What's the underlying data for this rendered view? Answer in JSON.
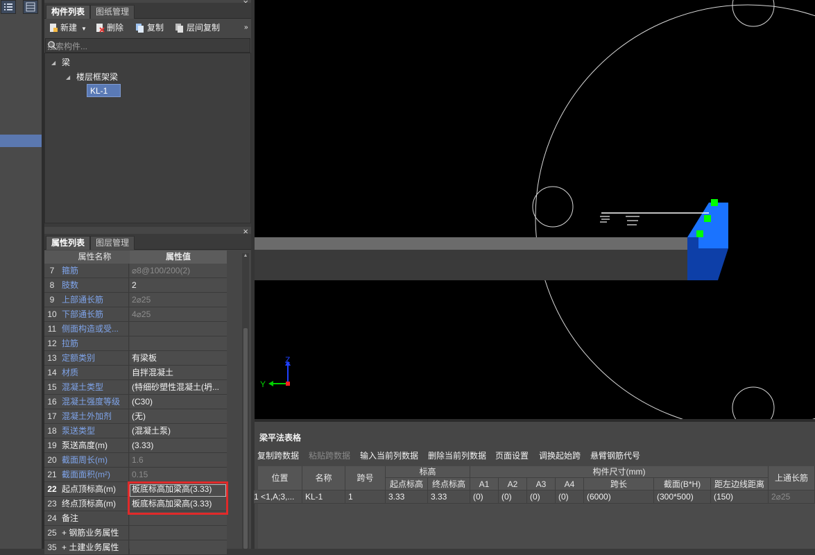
{
  "component_panel": {
    "tabs": [
      "构件列表",
      "图纸管理"
    ],
    "toolbar": {
      "new": "新建",
      "delete": "删除",
      "copy": "复制",
      "floor_copy": "层间复制"
    },
    "search_placeholder": "搜索构件...",
    "tree": {
      "root": "梁",
      "group": "楼层框架梁",
      "item": "KL-1"
    }
  },
  "properties_panel": {
    "tabs": [
      "属性列表",
      "图层管理"
    ],
    "headers": {
      "name": "属性名称",
      "value": "属性值"
    },
    "rows": [
      {
        "num": "7",
        "name": "箍筋",
        "value": "⌀8@100/200(2)",
        "name_style": "blue",
        "value_style": "grey"
      },
      {
        "num": "8",
        "name": "肢数",
        "value": "2",
        "name_style": "blue",
        "value_style": "white"
      },
      {
        "num": "9",
        "name": "上部通长筋",
        "value": "2⌀25",
        "name_style": "blue",
        "value_style": "grey"
      },
      {
        "num": "10",
        "name": "下部通长筋",
        "value": "4⌀25",
        "name_style": "blue",
        "value_style": "grey"
      },
      {
        "num": "11",
        "name": "侧面构造或受...",
        "value": "",
        "name_style": "blue",
        "value_style": "grey"
      },
      {
        "num": "12",
        "name": "拉筋",
        "value": "",
        "name_style": "blue",
        "value_style": "grey"
      },
      {
        "num": "13",
        "name": "定额类别",
        "value": "有梁板",
        "name_style": "blue",
        "value_style": "white"
      },
      {
        "num": "14",
        "name": "材质",
        "value": "自拌混凝土",
        "name_style": "blue",
        "value_style": "white"
      },
      {
        "num": "15",
        "name": "混凝土类型",
        "value": "(特细砂塑性混凝土(坍...",
        "name_style": "blue",
        "value_style": "white"
      },
      {
        "num": "16",
        "name": "混凝土强度等级",
        "value": "(C30)",
        "name_style": "blue",
        "value_style": "white"
      },
      {
        "num": "17",
        "name": "混凝土外加剂",
        "value": "(无)",
        "name_style": "blue",
        "value_style": "white"
      },
      {
        "num": "18",
        "name": "泵送类型",
        "value": "(混凝土泵)",
        "name_style": "blue",
        "value_style": "white"
      },
      {
        "num": "19",
        "name": "泵送高度(m)",
        "value": "(3.33)",
        "name_style": "white",
        "value_style": "white"
      },
      {
        "num": "20",
        "name": "截面周长(m)",
        "value": "1.6",
        "name_style": "blue",
        "value_style": "grey"
      },
      {
        "num": "21",
        "name": "截面面积(m²)",
        "value": "0.15",
        "name_style": "blue",
        "value_style": "grey"
      },
      {
        "num": "22",
        "name": "起点顶标高(m)",
        "value": "板底标高加梁高(3.33)",
        "name_style": "white",
        "value_style": "white",
        "bold_num": true
      },
      {
        "num": "23",
        "name": "终点顶标高(m)",
        "value": "板底标高加梁高(3.33)",
        "name_style": "white",
        "value_style": "white"
      },
      {
        "num": "24",
        "name": "备注",
        "value": "",
        "name_style": "white",
        "value_style": "white"
      },
      {
        "num": "25",
        "name": "+  钢筋业务属性",
        "value": "",
        "name_style": "white",
        "value_style": "white"
      },
      {
        "num": "35",
        "name": "+  土建业务属性",
        "value": "",
        "name_style": "white",
        "value_style": "white"
      }
    ]
  },
  "viewport": {
    "axis_z": "Z",
    "axis_y": "Y",
    "colors": {
      "background": "#000000",
      "beam_side": "#3a3a3a",
      "beam_top": "#6b6b6b",
      "column": "#1a73ff",
      "grip": "#00ff00"
    }
  },
  "bottom_panel": {
    "title": "梁平法表格",
    "toolbar": [
      "复制跨数据",
      "粘贴跨数据",
      "输入当前列数据",
      "删除当前列数据",
      "页面设置",
      "调换起始跨",
      "悬臂钢筋代号"
    ],
    "toolbar_disabled": [
      false,
      true,
      false,
      false,
      false,
      false,
      false
    ],
    "headers": {
      "position": "位置",
      "name": "名称",
      "span_no": "跨号",
      "elevation": "标高",
      "start_elev": "起点标高",
      "end_elev": "终点标高",
      "size_group": "构件尺寸(mm)",
      "a1": "A1",
      "a2": "A2",
      "a3": "A3",
      "a4": "A4",
      "span_len": "跨长",
      "section": "截面(B*H)",
      "offset": "距左边线距离",
      "top_rebar": "上通长筋"
    },
    "row": {
      "index": "1",
      "position": "<1,A;3,...",
      "name": "KL-1",
      "span_no": "1",
      "start_elev": "3.33",
      "end_elev": "3.33",
      "a1": "(0)",
      "a2": "(0)",
      "a3": "(0)",
      "a4": "(0)",
      "span_len": "(6000)",
      "section": "(300*500)",
      "offset": "(150)",
      "top_rebar": "2⌀25"
    }
  }
}
